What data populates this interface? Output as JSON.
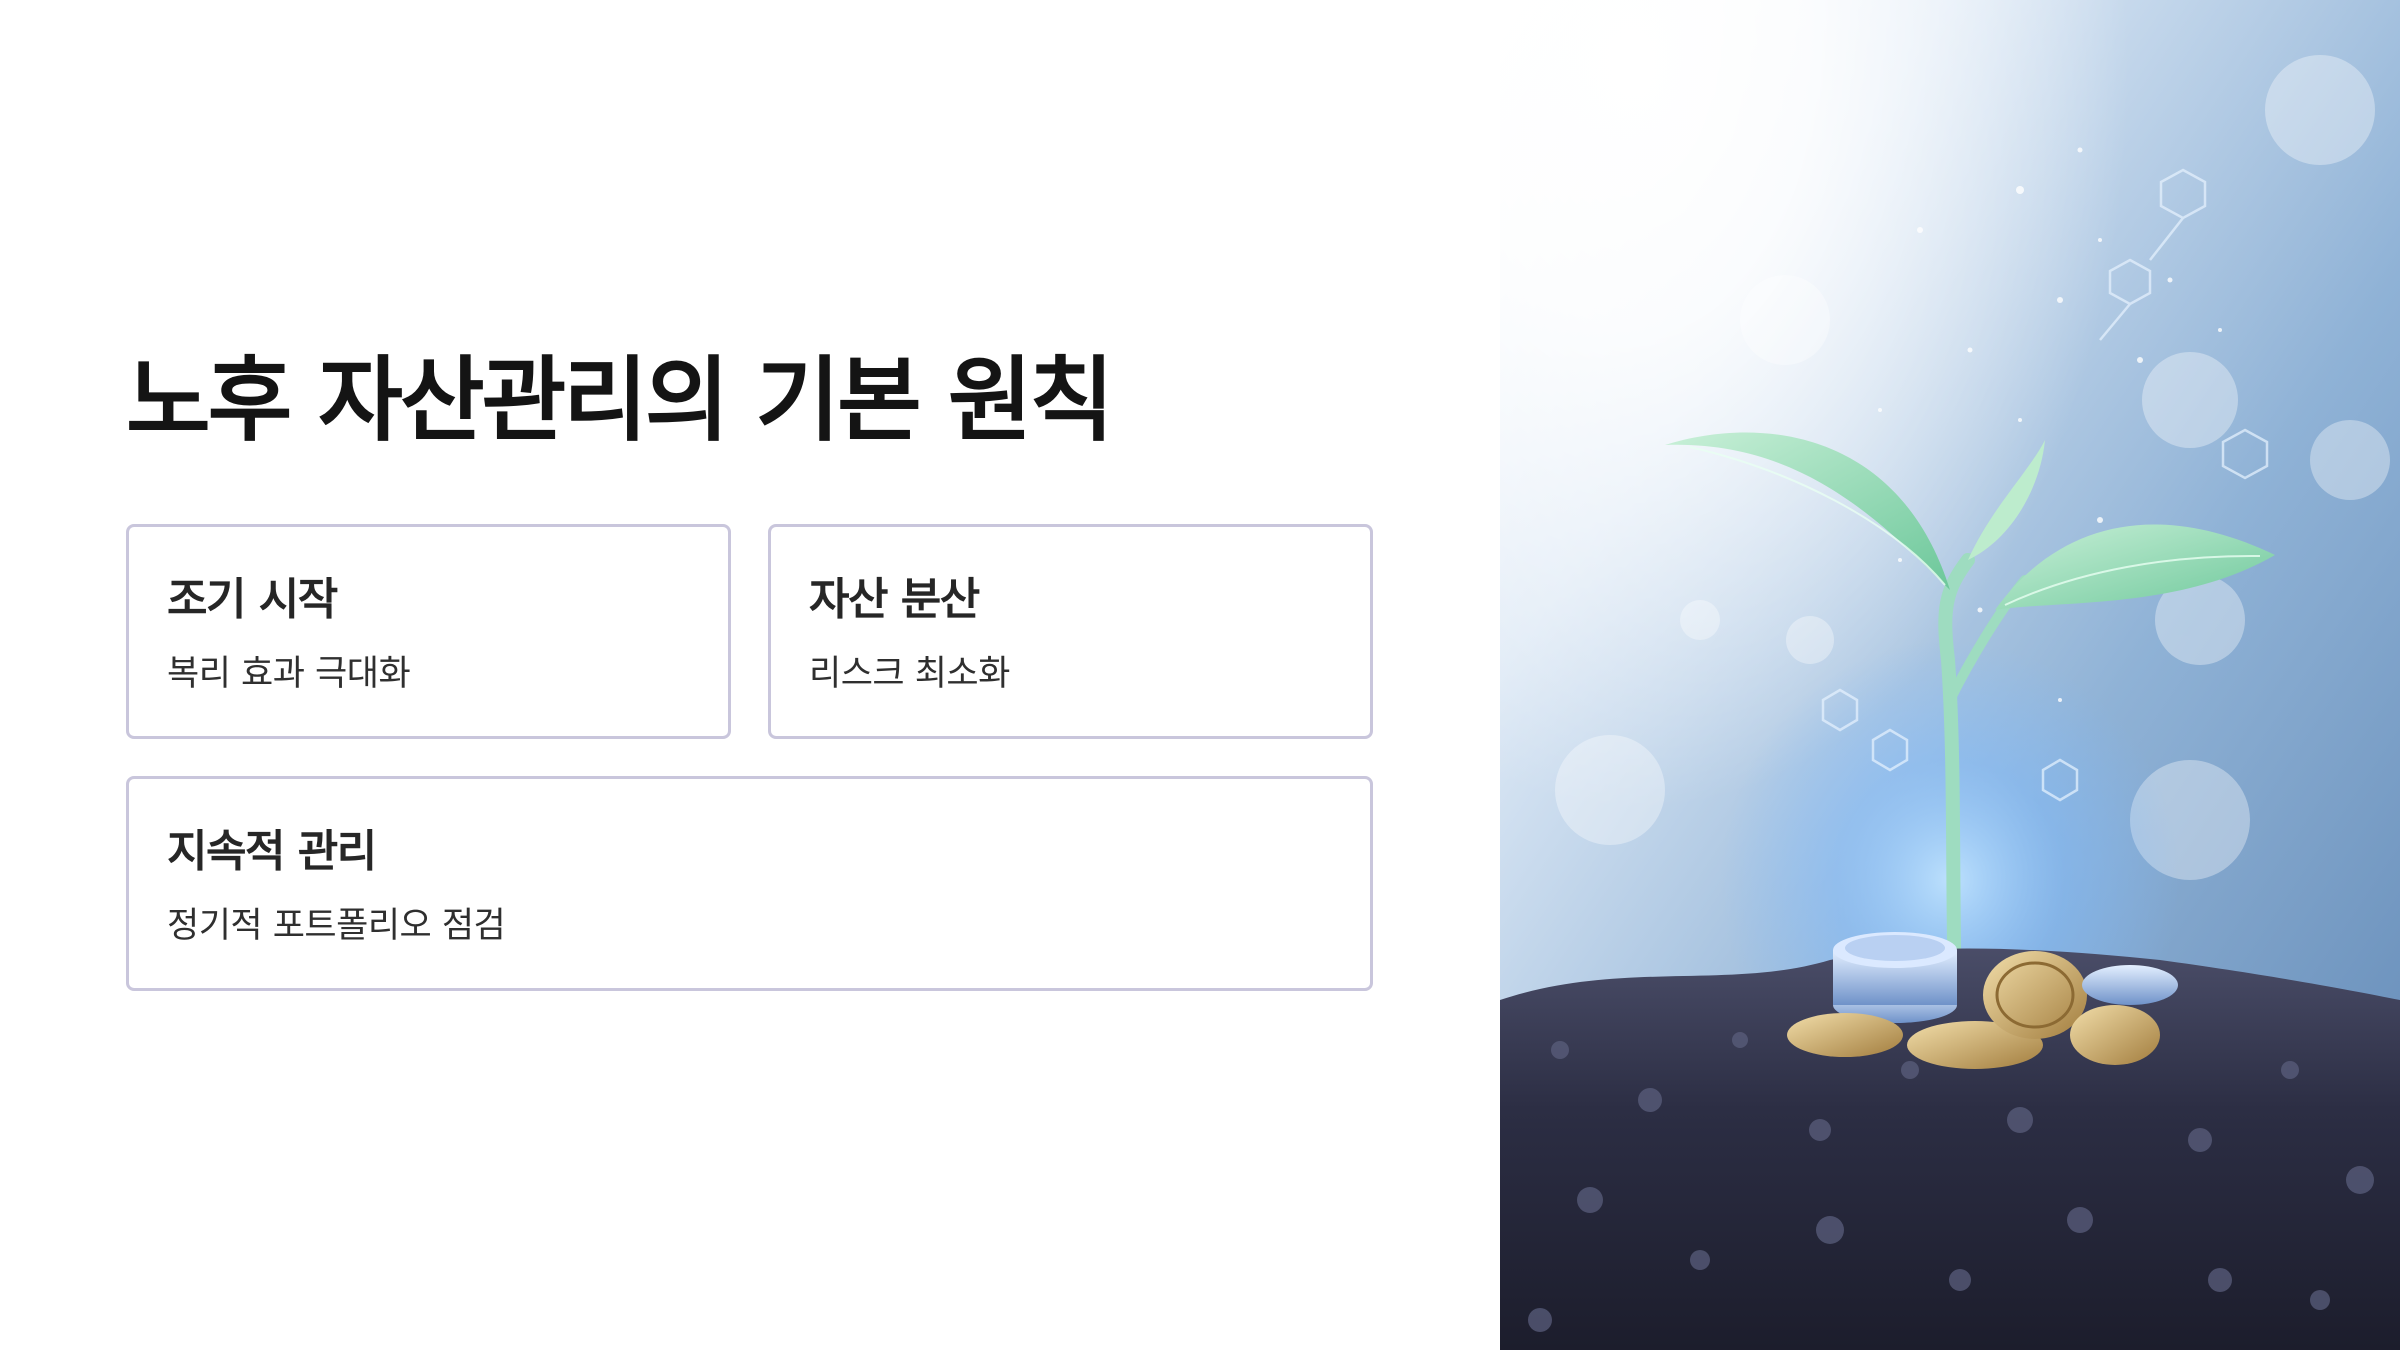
{
  "slide": {
    "title": "노후 자산관리의 기본 원칙",
    "cards": [
      {
        "title": "조기 시작",
        "description": "복리 효과 극대화"
      },
      {
        "title": "자산 분산",
        "description": "리스크 최소화"
      },
      {
        "title": "지속적 관리",
        "description": "정기적 포트폴리오 점검"
      }
    ]
  },
  "image": {
    "description_icon": "sprout-coins-soil-photo",
    "colors": {
      "sky_light": "#f4f8fd",
      "sky_blue": "#7aa2c9",
      "leaf": "#8fd6b0",
      "soil": "#2a2c40",
      "coin_gold": "#c9a766",
      "coin_blue": "#8fb0e0"
    }
  },
  "colors": {
    "title": "#141414",
    "card_border": "#c9c6dc",
    "card_title": "#262626",
    "card_desc": "#2f2f2f",
    "background": "#ffffff"
  }
}
